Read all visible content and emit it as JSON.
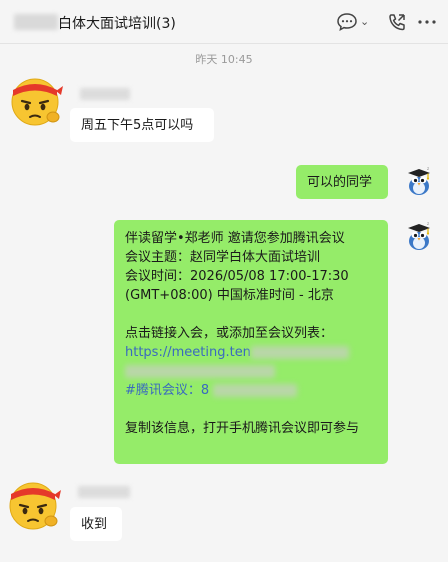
{
  "header": {
    "title": "白体大面试培训(3)",
    "icons": [
      "chat-bubble-icon",
      "chevron-down-icon",
      "phone-call-icon",
      "more-icon"
    ]
  },
  "chat": {
    "timestamp": "昨天 10:45",
    "messages": [
      {
        "sender": "other",
        "avatar": "angry-emoji-avatar",
        "text": "周五下午5点可以吗"
      },
      {
        "sender": "self",
        "avatar": "bird-mascot-avatar",
        "text": "可以的同学"
      },
      {
        "sender": "self",
        "avatar": "bird-mascot-avatar",
        "lines": [
          "伴读留学•郑老师 邀请您参加腾讯会议",
          "会议主题：赵同学白体大面试培训",
          "会议时间：2026/05/08 17:00-17:30",
          "(GMT+08:00) 中国标准时间 - 北京",
          "",
          "点击链接入会，或添加至会议列表：",
          "https://meeting.ten",
          "",
          "#腾讯会议：8",
          "",
          "复制该信息，打开手机腾讯会议即可参与"
        ]
      },
      {
        "sender": "other",
        "avatar": "angry-emoji-avatar",
        "text": "收到"
      }
    ]
  },
  "colors": {
    "background": "#f5f5f5",
    "self_bubble": "#95ec69",
    "other_bubble": "#ffffff",
    "link": "#3a6abf"
  }
}
